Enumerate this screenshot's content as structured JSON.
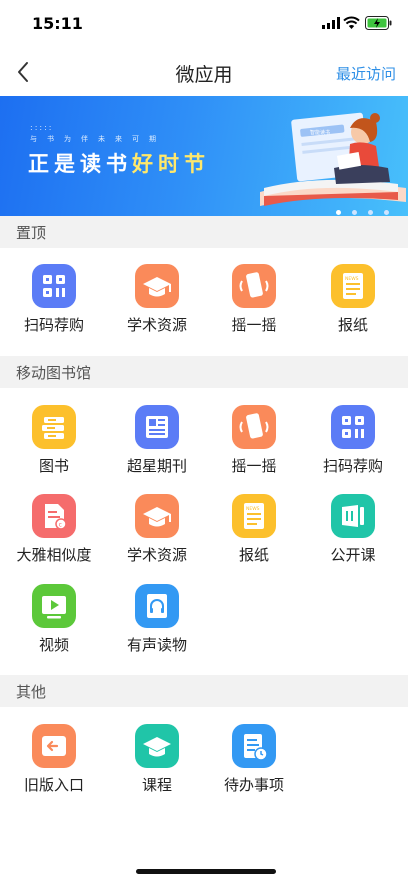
{
  "status": {
    "time": "15:11"
  },
  "nav": {
    "title": "微应用",
    "recent": "最近访问"
  },
  "banner": {
    "subtitle": "与书为伴未来可期",
    "headline_a": "正是读书",
    "headline_b": "好时节",
    "book_text": "智能读书"
  },
  "sections": {
    "pinned": "置顶",
    "mobile_library": "移动图书馆",
    "others": "其他"
  },
  "pinned_items": [
    "扫码荐购",
    "学术资源",
    "摇一摇",
    "报纸"
  ],
  "library_items": [
    "图书",
    "超星期刊",
    "摇一摇",
    "扫码荐购",
    "大雅相似度",
    "学术资源",
    "报纸",
    "公开课",
    "视频",
    "有声读物"
  ],
  "other_items": [
    "旧版入口",
    "课程",
    "待办事项"
  ],
  "icon_colors": {
    "blue": "#5b7cf6",
    "orange": "#fa8a5a",
    "yellow": "#fcc02c",
    "red": "#f56c6c",
    "teal": "#20c5a8",
    "green": "#5cc83a",
    "sky": "#3399f3"
  }
}
